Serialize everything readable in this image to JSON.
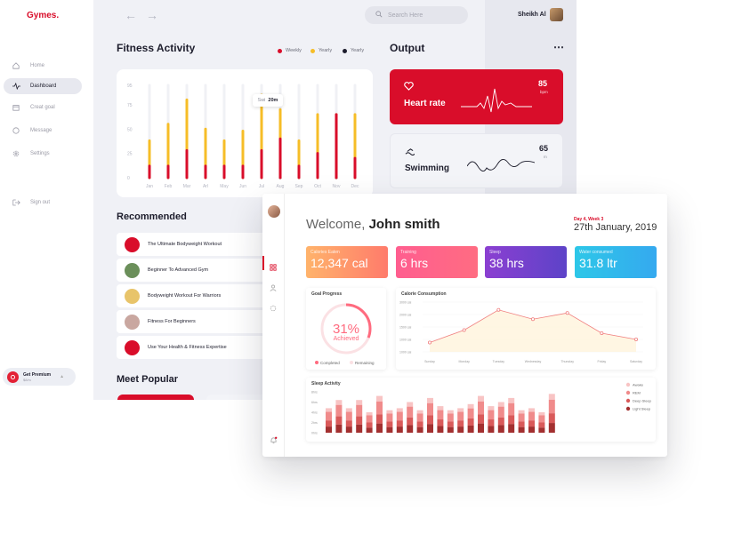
{
  "app": {
    "logo": "Gymes."
  },
  "sidebar": {
    "items": [
      {
        "label": "Home",
        "icon": "home-icon"
      },
      {
        "label": "Dashboard",
        "icon": "pulse-icon",
        "active": true
      },
      {
        "label": "Creat goal",
        "icon": "calendar-icon"
      },
      {
        "label": "Message",
        "icon": "chat-icon"
      },
      {
        "label": "Settings",
        "icon": "gear-icon"
      }
    ],
    "signout": "Sign out",
    "premium": {
      "title": "Get Premium",
      "price": "$8/m"
    }
  },
  "header": {
    "search_placeholder": "Search Here",
    "user_name": "Sheikh Al"
  },
  "fitness": {
    "title": "Fitness Activity",
    "legend": [
      {
        "label": "Weekly",
        "color": "#d90d2a"
      },
      {
        "label": "Yearly",
        "color": "#f6bd27"
      },
      {
        "label": "Yearly",
        "color": "#1d1d2c"
      }
    ],
    "tooltip": {
      "prefix": "Swi",
      "value": "20m"
    }
  },
  "chart_data": {
    "type": "bar",
    "categories": [
      "Jan",
      "Feb",
      "Mar",
      "Arl",
      "May",
      "Jun",
      "Jul",
      "Aug",
      "Sep",
      "Oct",
      "Nov",
      "Dec"
    ],
    "yticks": [
      0,
      25,
      50,
      75,
      95
    ],
    "ylim": [
      0,
      95
    ],
    "series": [
      {
        "name": "Weekly",
        "color": "#d90d2a",
        "values": [
          12,
          12,
          28,
          12,
          12,
          12,
          28,
          40,
          12,
          25,
          65,
          20
        ]
      },
      {
        "name": "Yearly",
        "color": "#f6bd27",
        "values": [
          38,
          55,
          80,
          50,
          38,
          48,
          85,
          70,
          38,
          65,
          65,
          65
        ]
      },
      {
        "name": "Yearly",
        "color": "#1d1d2c",
        "values": [
          0,
          0,
          0,
          0,
          0,
          0,
          0,
          28,
          0,
          0,
          35,
          0
        ]
      }
    ]
  },
  "output": {
    "title": "Output",
    "heart": {
      "label": "Heart rate",
      "value": "85",
      "unit": "bpm"
    },
    "swim": {
      "label": "Swimming",
      "value": "65",
      "unit": "m"
    }
  },
  "recommended": {
    "title": "Recommended",
    "items": [
      {
        "label": "The Ultimate Bodyweight Workout",
        "color": "#d90d2a"
      },
      {
        "label": "Beginner To Advanced Gym",
        "color": "#6b8f5a"
      },
      {
        "label": "Bodyweight Workout For Warriors",
        "color": "#e8c46a"
      },
      {
        "label": "Fitness For Beginners",
        "color": "#c9a7a0"
      },
      {
        "label": "Use Your Health & Fitness Expertise",
        "color": "#d90d2a"
      }
    ]
  },
  "popular": {
    "title": "Meet Popular"
  },
  "overlay": {
    "welcome": "Welcome,",
    "name": "John smith",
    "day": "Day 4, Week 3",
    "date": "27th January, 2019",
    "stats": [
      {
        "label": "Calories Eaten",
        "value": "12,347 cal",
        "c1": "#ffb36b",
        "c2": "#ff7b6b"
      },
      {
        "label": "Training",
        "value": "6 hrs",
        "c1": "#ff5e8f",
        "c2": "#ff6c82"
      },
      {
        "label": "Sleep",
        "value": "38 hrs",
        "c1": "#8b3fd1",
        "c2": "#5d43c8"
      },
      {
        "label": "Water consumed",
        "value": "31.8 ltr",
        "c1": "#2dc7e8",
        "c2": "#35a9ef"
      }
    ],
    "goal": {
      "title": "Goal Progress",
      "percent": "31%",
      "sub": "Achieved",
      "legend": [
        "Completed",
        "Remaining"
      ],
      "progress": 0.31
    },
    "calorie": {
      "title": "Calorie Consumption",
      "ylabels": [
        "3000 cal",
        "2000 cal",
        "1500 cal",
        "1000 cal",
        "1000 cal"
      ],
      "days": [
        "Sunday",
        "Monday",
        "Tuesday",
        "Wednesday",
        "Thursday",
        "Friday",
        "Saturday"
      ],
      "values": [
        1100,
        1500,
        2150,
        1850,
        2050,
        1400,
        1200
      ]
    },
    "sleep": {
      "title": "Sleep Activity",
      "ylabels": [
        "8hrs",
        "6hrs",
        "4hrs",
        "2hrs",
        "0hrs"
      ],
      "legend": [
        {
          "label": "Awake",
          "color": "#f8c4c4"
        },
        {
          "label": "REM",
          "color": "#f08b8b"
        },
        {
          "label": "Deep Sleep",
          "color": "#d95a5a"
        },
        {
          "label": "Light Sleep",
          "color": "#a33030"
        }
      ],
      "bars": [
        0.6,
        0.8,
        0.6,
        0.8,
        0.5,
        0.9,
        0.55,
        0.6,
        0.75,
        0.55,
        0.85,
        0.65,
        0.55,
        0.6,
        0.7,
        0.9,
        0.65,
        0.75,
        0.85,
        0.55,
        0.6,
        0.5,
        0.95
      ]
    }
  }
}
